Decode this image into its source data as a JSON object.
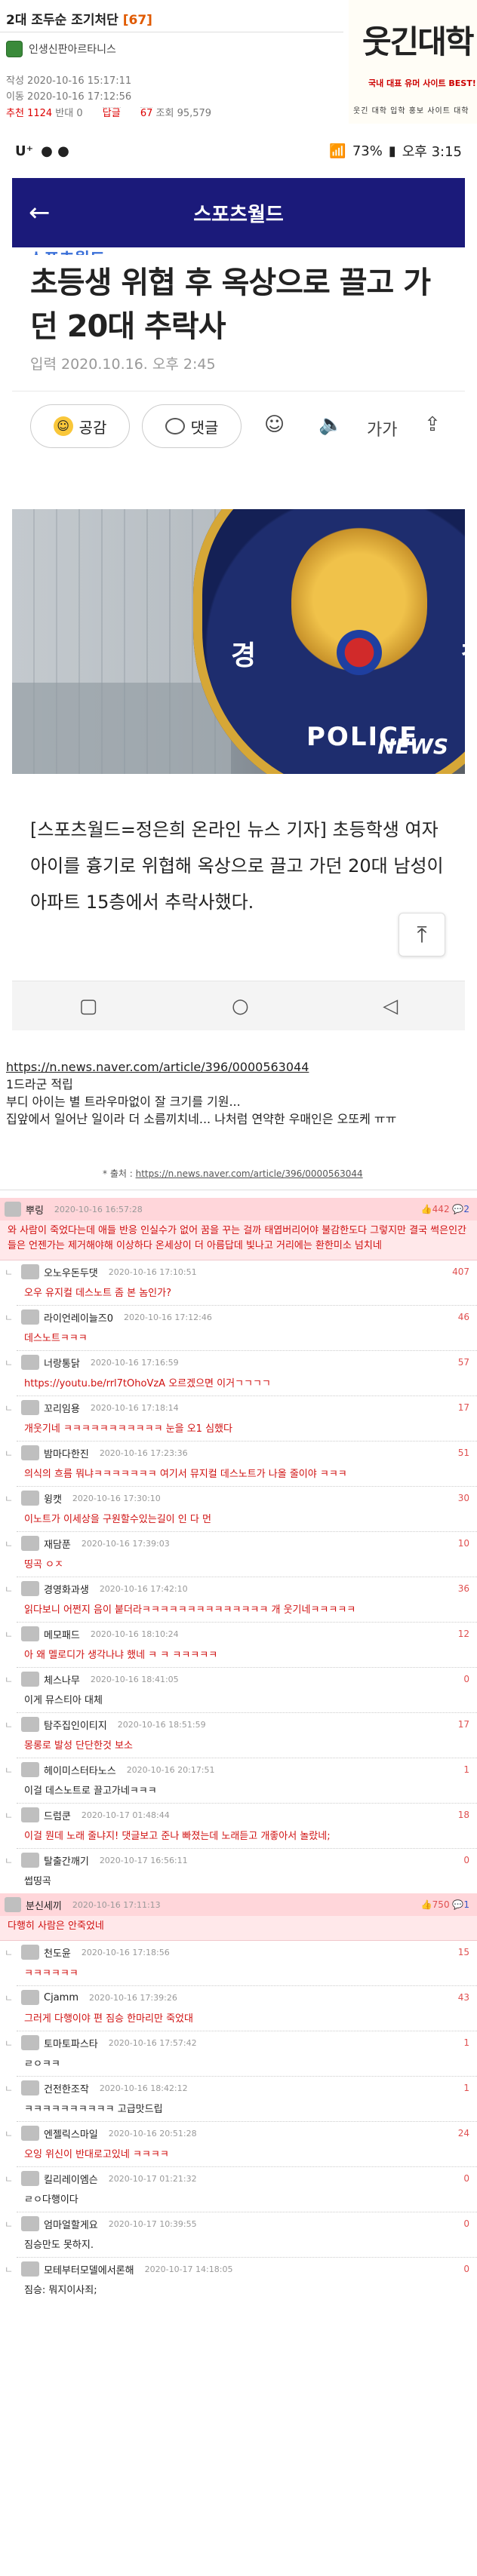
{
  "post": {
    "title": "2대 조두순 조기처단",
    "count": "[67]",
    "author": "인생신판아르타니스",
    "created": "작성 2020-10-16 15:17:11",
    "modified": "이동 2020-10-16 17:12:56",
    "stats_rec_label": "추천",
    "stats_rec": "1124",
    "stats_ban_label": "반대",
    "stats_ban": "0",
    "stats_reply_label": "답글",
    "stats_reply": "67",
    "stats_view_label": "조회",
    "stats_view": "95,579"
  },
  "logo": {
    "title": "웃긴대학",
    "subtitle": "국내 대표 유머 사이트 BEST!",
    "icons": "웃긴 대학 입학 홍보 사이트 대학"
  },
  "phone": {
    "status_left": "U⁺",
    "status_battery": "73%",
    "status_time": "오후 3:15",
    "nav_title": "스포츠월드",
    "brand": "스포츠월드",
    "headline": "초등생 위협 후 옥상으로 끌고 가던 20대 추락사",
    "input_date": "입력 2020.10.16. 오후 2:45",
    "btn_like": "공감",
    "btn_comment": "댓글",
    "tool_font": "가가",
    "photo_left": "경",
    "photo_right": "찰",
    "photo_police": "POLICE",
    "photo_mark": "NEWS",
    "body": "[스포츠월드=정은희 온라인 뉴스 기자] 초등학생 여자아이를 흉기로 위협해 옥상으로 끌고 가던 20대 남성이 아파트 15층에서 추락사했다."
  },
  "link_area": {
    "url": "https://n.news.naver.com/article/396/0000563044",
    "line1": "1드라군 적립",
    "line2": "부디 아이는 별 트라우마없이 잘 크기를 기원...",
    "line3": "집앞에서 일어난 일이라 더 소름끼치네... 나처럼 연약한 우매인은 오또케 ㅠㅠ",
    "source_label": "* 출처 :",
    "source_url": "https://n.news.naver.com/article/396/0000563044"
  },
  "comments": [
    {
      "nick": "뿌링",
      "date": "2020-10-16 16:57:28",
      "score": "442",
      "replies": "2",
      "best": true,
      "text": "와 사람이 죽었다는데 애들 반응 인실수가 없어 꿈을 꾸는 걸까 태엽버리어야 불감한도다 그렇지만 결국 썩은인간들은 언젠가는 제거해야해 이상하다 온세상이 더 아름답데 빛나고 거리에는 환한미소 넘치네",
      "replies_list": [
        {
          "nick": "오노우돈두댓",
          "date": "2020-10-16 17:10:51",
          "score": "407",
          "text": "오우 유지컬 데스노트 좀 본 놈인가?",
          "dark": false
        },
        {
          "nick": "라이언레이늘즈0",
          "date": "2020-10-16 17:12:46",
          "score": "46",
          "text": "데스노트ㅋㅋㅋ",
          "dark": false
        },
        {
          "nick": "너랑통닭",
          "date": "2020-10-16 17:16:59",
          "score": "57",
          "text": "https://youtu.be/rrl7tOhoVzA 오르겠으면 이거ㄱㄱㄱㄱ",
          "dark": false
        },
        {
          "nick": "꼬리임용",
          "date": "2020-10-16 17:18:14",
          "score": "17",
          "text": "개웃기네 ㅋㅋㅋㅋㅋㅋㅋㅋㅋㅋㅋ 눈을 오1 심했다",
          "dark": false
        },
        {
          "nick": "밤마다한진",
          "date": "2020-10-16 17:23:36",
          "score": "51",
          "text": "의식의 흐름 뭐냐ㅋㅋㅋㅋㅋㅋㅋ 여기서 뮤지컬 데스노트가 나올 줄이야 ㅋㅋㅋ",
          "dark": false
        },
        {
          "nick": "윙캣",
          "date": "2020-10-16 17:30:10",
          "score": "30",
          "text": "이노트가 이세상을 구원할수있는길이 인 다 먼",
          "dark": false
        },
        {
          "nick": "재담푼",
          "date": "2020-10-16 17:39:03",
          "score": "10",
          "text": "띵곡 ㅇㅈ",
          "dark": false
        },
        {
          "nick": "경영화과생",
          "date": "2020-10-16 17:42:10",
          "score": "36",
          "text": "읽다보니 어쩐지 음이 붙더라ㅋㅋㅋㅋㅋㅋㅋㅋㅋㅋㅋㅋㅋㅋ 개 웃기네ㅋㅋㅋㅋㅋ",
          "dark": false
        },
        {
          "nick": "메모패드",
          "date": "2020-10-16 18:10:24",
          "score": "12",
          "text": "아 왜 멜로디가 생각나냐 했네 ㅋ ㅋ ㅋㅋㅋㅋㅋ",
          "dark": false
        },
        {
          "nick": "체스나무",
          "date": "2020-10-16 18:41:05",
          "score": "0",
          "text": "이게 뮤스티아 대체",
          "dark": true
        },
        {
          "nick": "탐주집인이티지",
          "date": "2020-10-16 18:51:59",
          "score": "17",
          "text": "몽롱로 발성 단단한것 보소",
          "dark": false
        },
        {
          "nick": "헤이미스터타노스",
          "date": "2020-10-16 20:17:51",
          "score": "1",
          "text": "이걸 데스노트로 끌고가네ㅋㅋㅋ",
          "dark": true
        },
        {
          "nick": "드럼쿤",
          "date": "2020-10-17 01:48:44",
          "score": "18",
          "text": "이걸 뭔데 노래 줄냐지! 댓글보고 준나 빠졌는데 노래듣고 개좋아서 놀랐네;",
          "dark": false
        },
        {
          "nick": "탈출간깨기",
          "date": "2020-10-17 16:56:11",
          "score": "0",
          "text": "썹띵곡",
          "dark": true
        }
      ]
    },
    {
      "nick": "분신세끼",
      "date": "2020-10-16 17:11:13",
      "score": "750",
      "replies": "1",
      "best": true,
      "text": "다행히 사람은 안죽었네",
      "replies_list": [
        {
          "nick": "천도윤",
          "date": "2020-10-16 17:18:56",
          "score": "15",
          "text": "ㅋㅋㅋㅋㅋㅋ",
          "dark": false
        },
        {
          "nick": "Cjamm",
          "date": "2020-10-16 17:39:26",
          "score": "43",
          "text": "그러게 다행이야 편 짐승 한마리만 죽었대",
          "dark": false
        },
        {
          "nick": "토마토파스타",
          "date": "2020-10-16 17:57:42",
          "score": "1",
          "text": "ㄹㅇㅋㅋ",
          "dark": true
        },
        {
          "nick": "건전한조작",
          "date": "2020-10-16 18:42:12",
          "score": "1",
          "text": "ㅋㅋㅋㅋㅋㅋㅋㅋㅋㅋ 고급맛드립",
          "dark": true
        },
        {
          "nick": "엔젤릭스마일",
          "date": "2020-10-16 20:51:28",
          "score": "24",
          "text": "오잉 위신이 반대로고있네 ㅋㅋㅋㅋ",
          "dark": false
        },
        {
          "nick": "킬리레이엠슨",
          "date": "2020-10-17 01:21:32",
          "score": "0",
          "text": "ㄹㅇ다행이다",
          "dark": true
        },
        {
          "nick": "엄마얼할게요",
          "date": "2020-10-17 10:39:55",
          "score": "0",
          "text": "짐승만도 못하지.",
          "dark": true
        },
        {
          "nick": "모테부터모델에서론해",
          "date": "2020-10-17 14:18:05",
          "score": "0",
          "text": "짐승: 뭐지이사죄;",
          "dark": true
        }
      ]
    }
  ],
  "colors": {
    "nav": "#1b1a7a",
    "best_bg": "#ffe8ea",
    "red": "#d01010",
    "score": "#e05050",
    "reply_cnt": "#3055c8"
  }
}
